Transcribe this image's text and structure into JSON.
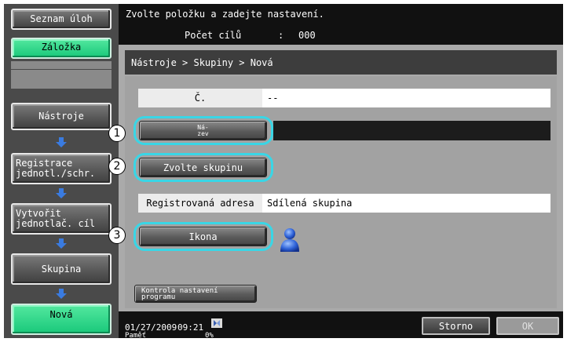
{
  "sidebar": {
    "job_list": "Seznam úloh",
    "bookmark": "Záložka",
    "steps": [
      {
        "label": "Nástroje"
      },
      {
        "label": "Registrace jednotl./schr."
      },
      {
        "label": "Vytvořit jednotlač. cíl"
      },
      {
        "label": "Skupina"
      },
      {
        "label": "Nová"
      }
    ]
  },
  "message": {
    "instruction": "Zvolte položku a zadejte nastavení.",
    "dest_count_label": "Počet cílů",
    "dest_count_colon": ":",
    "dest_count_value": "000"
  },
  "breadcrumb": "Nástroje > Skupiny > Nová",
  "form": {
    "number_label": "Č.",
    "number_value": "--",
    "name_button_line1": "Ná-",
    "name_button_line2": "zev",
    "name_value": "",
    "group_button": "Zvolte skupinu",
    "address_label": "Registrovaná adresa",
    "address_value": "Sdílená skupina",
    "icon_button": "Ikona",
    "program_check_line1": "Kontrola nastavení",
    "program_check_line2": "programu"
  },
  "callouts": [
    "1",
    "2",
    "3"
  ],
  "status": {
    "date": "01/27/2009",
    "time": "09:21",
    "memory_label": "Paměť",
    "memory_value": "0%",
    "cancel": "Storno",
    "ok": "OK"
  },
  "colors": {
    "highlight": "#39d6e6",
    "accent_green": "#19c87a",
    "arrow_blue": "#3a7be0"
  },
  "icons": {
    "selected_icon": "person-icon",
    "network": "network-status-icon"
  }
}
